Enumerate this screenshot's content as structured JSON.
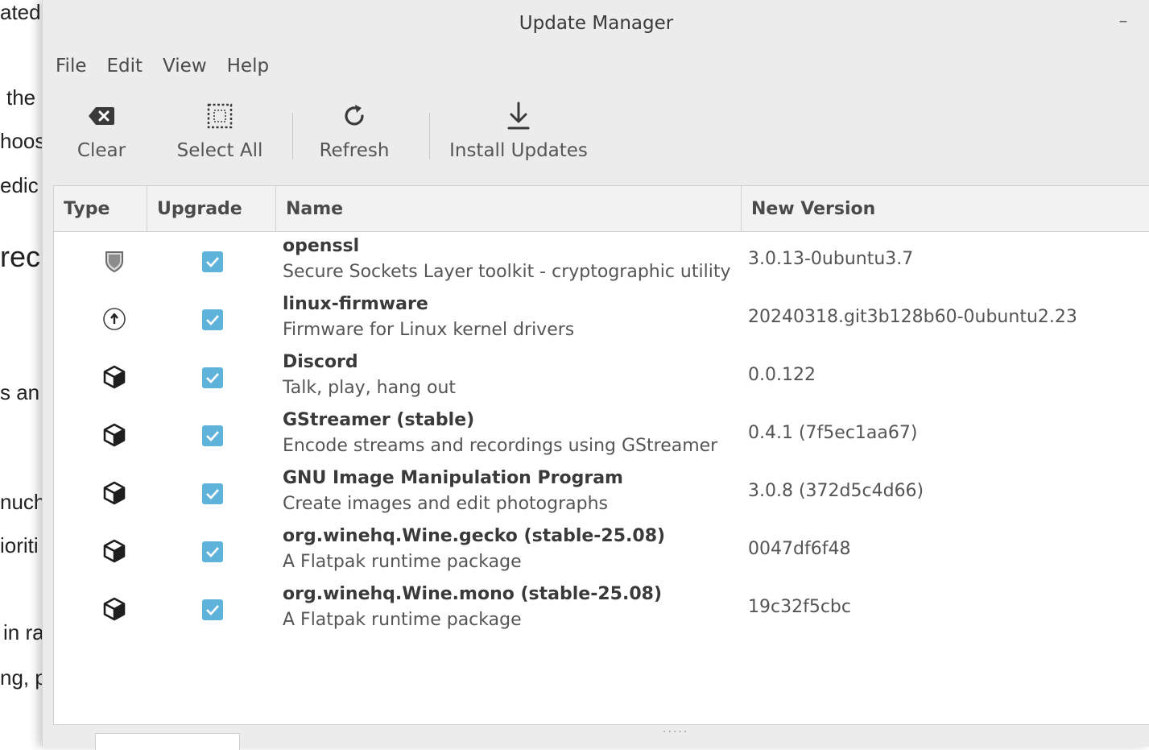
{
  "background_text": {
    "lines": [
      "ated",
      "the",
      "hoos",
      "edic",
      "rec",
      "s an",
      "nuch",
      "ioriti",
      "in ra",
      "ng, p"
    ]
  },
  "window": {
    "title": "Update Manager",
    "minimize_glyph": "–"
  },
  "menu": {
    "items": [
      "File",
      "Edit",
      "View",
      "Help"
    ]
  },
  "toolbar": {
    "clear": "Clear",
    "select_all": "Select All",
    "refresh": "Refresh",
    "install": "Install Updates"
  },
  "table": {
    "columns": [
      "Type",
      "Upgrade",
      "Name",
      "New Version"
    ],
    "rows": [
      {
        "type_icon": "security-shield-icon",
        "checked": true,
        "name": "openssl",
        "desc": "Secure Sockets Layer toolkit - cryptographic utility",
        "version": "3.0.13-0ubuntu3.7"
      },
      {
        "type_icon": "upgrade-arrow-icon",
        "checked": true,
        "name": "linux-firmware",
        "desc": "Firmware for Linux kernel drivers",
        "version": "20240318.git3b128b60-0ubuntu2.23"
      },
      {
        "type_icon": "package-cube-icon",
        "checked": true,
        "name": "Discord",
        "desc": "Talk, play, hang out",
        "version": "0.0.122"
      },
      {
        "type_icon": "package-cube-icon",
        "checked": true,
        "name": "GStreamer (stable)",
        "desc": "Encode streams and recordings using GStreamer",
        "version": "0.4.1 (7f5ec1aa67)"
      },
      {
        "type_icon": "package-cube-icon",
        "checked": true,
        "name": "GNU Image Manipulation Program",
        "desc": "Create images and edit photographs",
        "version": "3.0.8 (372d5c4d66)"
      },
      {
        "type_icon": "package-cube-icon",
        "checked": true,
        "name": "org.winehq.Wine.gecko (stable-25.08)",
        "desc": "A Flatpak runtime package",
        "version": "0047df6f48"
      },
      {
        "type_icon": "package-cube-icon",
        "checked": true,
        "name": "org.winehq.Wine.mono (stable-25.08)",
        "desc": "A Flatpak runtime package",
        "version": "19c32f5cbc"
      }
    ]
  },
  "colors": {
    "checkbox": "#5fb3db",
    "window_bg": "#ececec"
  }
}
